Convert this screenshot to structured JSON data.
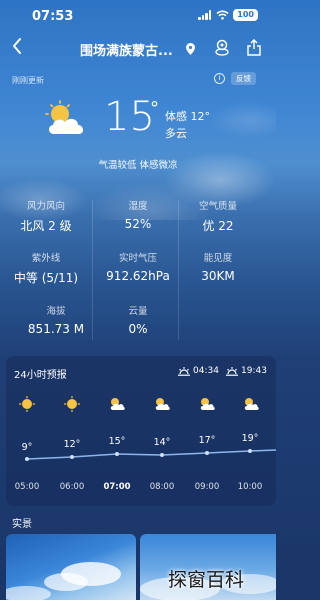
{
  "status_bar": {
    "time": "07:53",
    "battery": "100"
  },
  "nav": {
    "city": "围场满族蒙古..."
  },
  "refresh": {
    "text": "刚刚更新",
    "feedback": "反馈"
  },
  "current": {
    "temperature": "15",
    "degree": "°",
    "feels_like": "体感 12°",
    "condition": "多云",
    "description": "气温较低 体感微凉",
    "icon": "partly-cloudy-icon"
  },
  "details": [
    {
      "label": "风力风向",
      "value": "北风 2 级"
    },
    {
      "label": "湿度",
      "value": "52%"
    },
    {
      "label": "空气质量",
      "value": "优 22"
    },
    {
      "label": "紫外线",
      "value": "中等 (5/11)"
    },
    {
      "label": "实时气压",
      "value": "912.62hPa"
    },
    {
      "label": "能见度",
      "value": "30KM"
    },
    {
      "label": "海拔",
      "value": "851.73 M"
    },
    {
      "label": "云量",
      "value": "0%"
    }
  ],
  "forecast": {
    "title": "24小时预报",
    "sunrise": "04:34",
    "sunset": "19:43",
    "hours": [
      {
        "time": "05:00",
        "temp": "9°",
        "icon": "sun-icon"
      },
      {
        "time": "06:00",
        "temp": "12°",
        "icon": "sun-icon"
      },
      {
        "time": "07:00",
        "temp": "15°",
        "icon": "partly-cloudy-icon"
      },
      {
        "time": "08:00",
        "temp": "14°",
        "icon": "partly-cloudy-icon"
      },
      {
        "time": "09:00",
        "temp": "17°",
        "icon": "partly-cloudy-icon"
      },
      {
        "time": "10:00",
        "temp": "19°",
        "icon": "partly-cloudy-icon"
      }
    ]
  },
  "scene": {
    "title": "实景"
  },
  "watermark": "探窗百科",
  "colors": {
    "accent_line": "#8fb6ea",
    "sun": "#f6c343"
  }
}
